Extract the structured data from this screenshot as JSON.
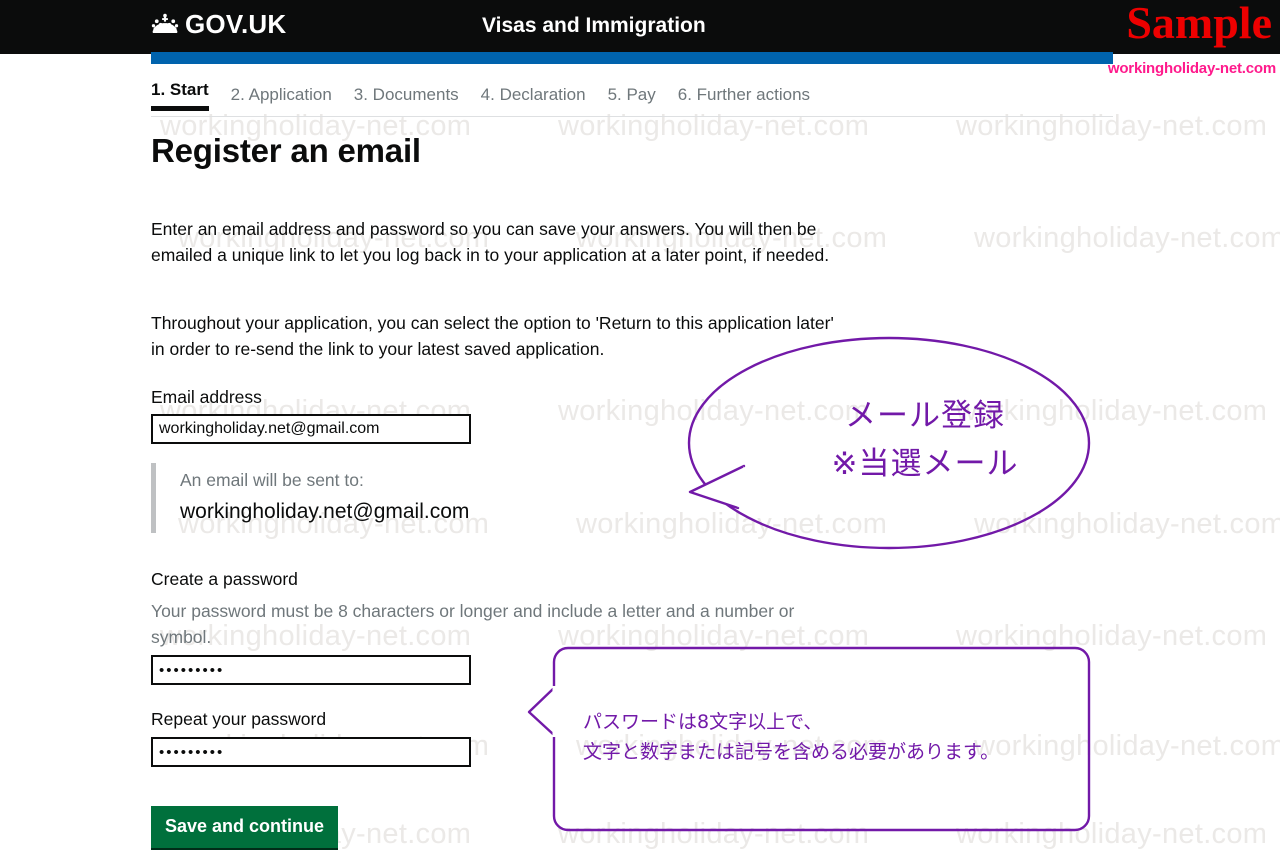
{
  "header": {
    "logo_text": "GOV.UK",
    "crown_icon": "crown-icon",
    "service_name": "Visas and Immigration"
  },
  "watermark": {
    "sample_text": "Sample",
    "site_url": "workingholiday-net.com",
    "tile_text": "workingholiday-net.com",
    "sample_color": "#ee0000",
    "url_color": "#ff1a8c",
    "tile_color": "#ebe9e7"
  },
  "phase_bar": {
    "color": "#0063ad"
  },
  "steps": [
    {
      "label": "1. Start",
      "active": true
    },
    {
      "label": "2. Application",
      "active": false
    },
    {
      "label": "3. Documents",
      "active": false
    },
    {
      "label": "4. Declaration",
      "active": false
    },
    {
      "label": "5. Pay",
      "active": false
    },
    {
      "label": "6. Further actions",
      "active": false
    }
  ],
  "main": {
    "title": "Register an email",
    "paragraph_1": "Enter an email address and password so you can save your answers. You will then be emailed a unique link to let you log back in to your application at a later point, if needed.",
    "paragraph_2": "Throughout your application, you can select the option to 'Return to this application later' in order to re-send the link to your latest saved application."
  },
  "form": {
    "email_label": "Email address",
    "email_value": "workingholiday.net@gmail.com",
    "email_placeholder": "",
    "inset_title": "An email will be sent to:",
    "inset_value": "workingholiday.net@gmail.com",
    "password_label": "Create a password",
    "password_hint": "Your password must be 8 characters or longer and include a letter and a number or symbol.",
    "password_value": "•••••••••",
    "password_repeat_label": "Repeat your password",
    "password_repeat_value": "•••••••••",
    "submit_label": "Save and continue",
    "submit_color": "#00703c"
  },
  "annotations": {
    "oval_line_1": "メール登録",
    "oval_line_2": "※当選メール",
    "rect_line_1": "パスワードは8文字以上で、",
    "rect_line_2": "文字と数字または記号を含める必要があります。",
    "color": "#7219a8"
  }
}
